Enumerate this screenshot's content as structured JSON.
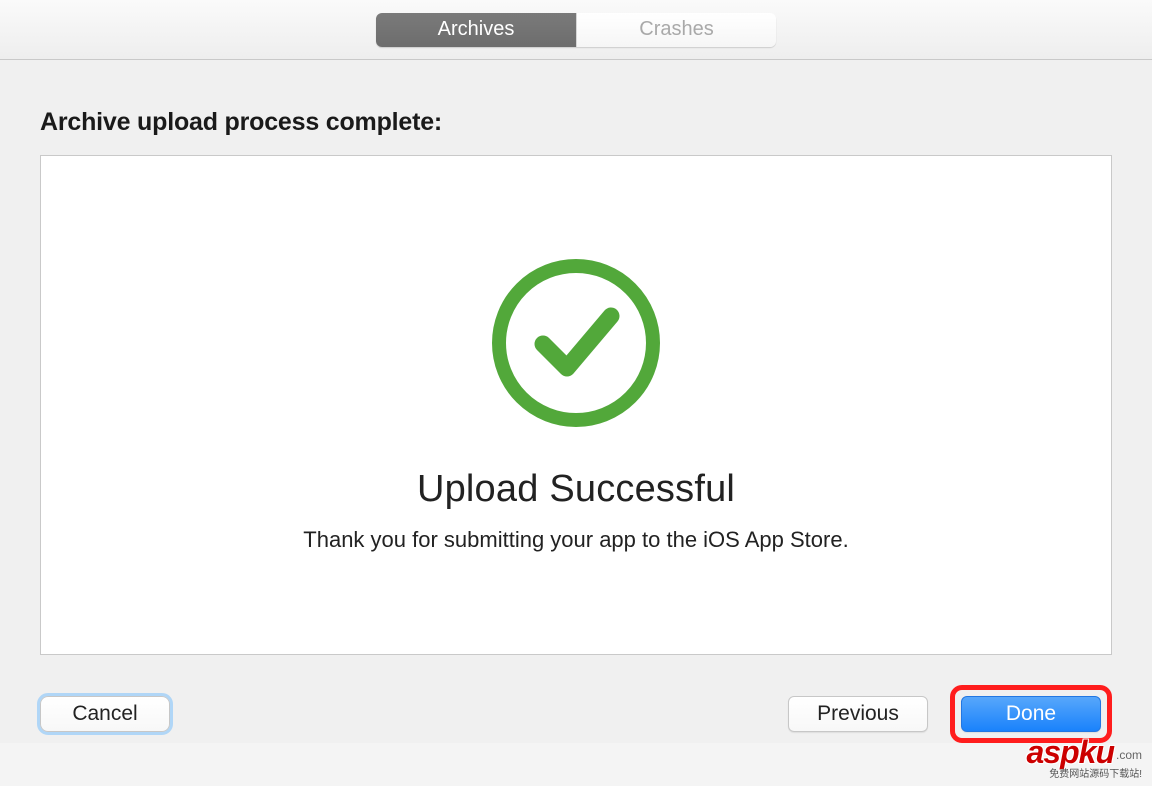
{
  "tabs": {
    "archives": "Archives",
    "crashes": "Crashes"
  },
  "dialog": {
    "title": "Archive upload process complete:",
    "success_title": "Upload Successful",
    "success_subtitle": "Thank you for submitting your app to the iOS App Store."
  },
  "buttons": {
    "cancel": "Cancel",
    "previous": "Previous",
    "done": "Done"
  },
  "colors": {
    "success_green": "#52a83a",
    "primary_blue": "#1a82fb",
    "highlight_red": "#ff1d1d"
  },
  "watermark": {
    "main": "aspku",
    "dotcom": ".com",
    "sub": "免费网站源码下载站!"
  }
}
